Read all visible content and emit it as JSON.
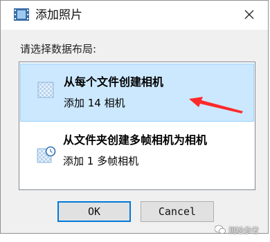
{
  "window": {
    "title": "添加照片",
    "icon": "film-strip-icon",
    "close_icon": "close-icon"
  },
  "prompt": "请选择数据布局:",
  "options": [
    {
      "title": "从每个文件创建相机",
      "subtitle": "添加 14 相机",
      "icon": "checkered-image-icon",
      "selected": true
    },
    {
      "title": "从文件夹创建多帧相机为相机",
      "subtitle": "添加 1 多帧相机",
      "icon": "image-clock-icon",
      "selected": false
    }
  ],
  "buttons": {
    "ok": "OK",
    "cancel": "Cancel"
  },
  "watermark": {
    "text": "测绘参考",
    "icon": "wechat-icon"
  },
  "colors": {
    "selection_bg": "#cce8ff",
    "selection_border": "#99d1ff",
    "arrow": "#ff2a2a",
    "focus_border": "#0078d7"
  }
}
